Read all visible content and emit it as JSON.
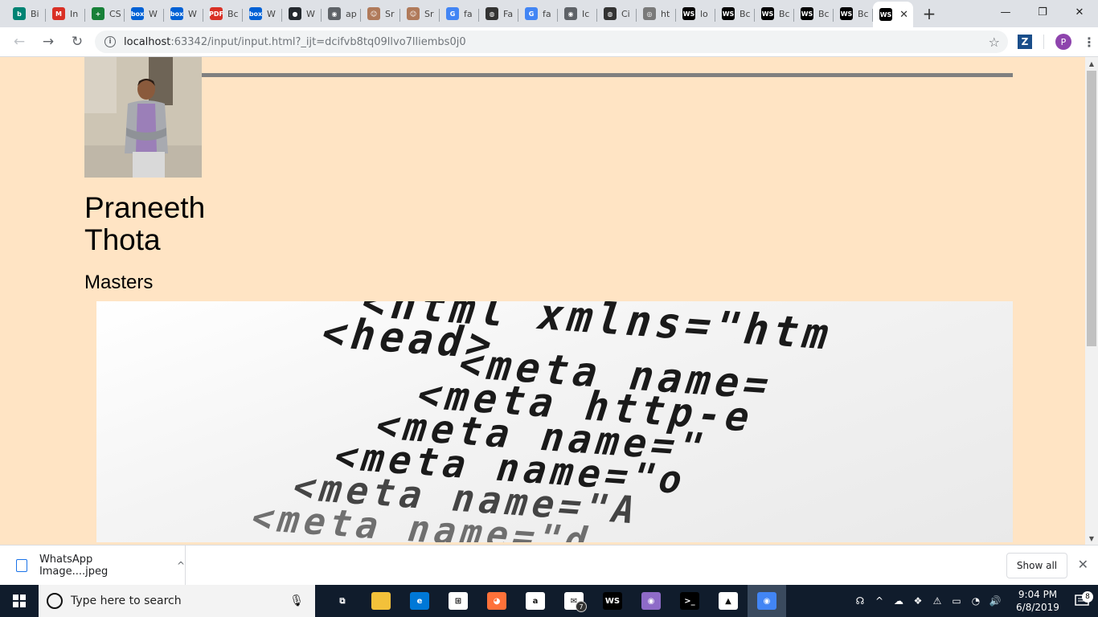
{
  "browser": {
    "tabs": [
      {
        "label": "Bi",
        "icon": "bing-icon",
        "color": "#008373",
        "glyph": "b"
      },
      {
        "label": "In",
        "icon": "gmail-icon",
        "color": "#d93025",
        "glyph": "M"
      },
      {
        "label": "CS",
        "icon": "sheets-icon",
        "color": "#188038",
        "glyph": "+"
      },
      {
        "label": "W",
        "icon": "box-icon",
        "color": "#0061d5",
        "glyph": "box"
      },
      {
        "label": "W",
        "icon": "box-icon",
        "color": "#0061d5",
        "glyph": "box"
      },
      {
        "label": "Bc",
        "icon": "pdf-icon",
        "color": "#d93025",
        "glyph": "PDF"
      },
      {
        "label": "W",
        "icon": "box-icon",
        "color": "#0061d5",
        "glyph": "box"
      },
      {
        "label": "W",
        "icon": "github-icon",
        "color": "#24292e",
        "glyph": "●"
      },
      {
        "label": "ap",
        "icon": "globe-icon",
        "color": "#5f6368",
        "glyph": "◉"
      },
      {
        "label": "Sr",
        "icon": "person-icon",
        "color": "#b07a5a",
        "glyph": "☺"
      },
      {
        "label": "Sr",
        "icon": "person-icon",
        "color": "#b07a5a",
        "glyph": "☺"
      },
      {
        "label": "fa",
        "icon": "google-icon",
        "color": "#4285f4",
        "glyph": "G"
      },
      {
        "label": "Fa",
        "icon": "eye-icon",
        "color": "#333333",
        "glyph": "◍"
      },
      {
        "label": "fa",
        "icon": "google-icon",
        "color": "#4285f4",
        "glyph": "G"
      },
      {
        "label": "Ic",
        "icon": "globe-icon",
        "color": "#5f6368",
        "glyph": "◉"
      },
      {
        "label": "Ci",
        "icon": "eye-icon",
        "color": "#333333",
        "glyph": "◍"
      },
      {
        "label": "ht",
        "icon": "wiki-icon",
        "color": "#7a7a7a",
        "glyph": "◎"
      },
      {
        "label": "lo",
        "icon": "webstorm-icon",
        "color": "#000000",
        "glyph": "WS"
      },
      {
        "label": "Bc",
        "icon": "webstorm-icon",
        "color": "#000000",
        "glyph": "WS"
      },
      {
        "label": "Bc",
        "icon": "webstorm-icon",
        "color": "#000000",
        "glyph": "WS"
      },
      {
        "label": "Bc",
        "icon": "webstorm-icon",
        "color": "#000000",
        "glyph": "WS"
      },
      {
        "label": "Bc",
        "icon": "webstorm-icon",
        "color": "#000000",
        "glyph": "WS"
      }
    ],
    "active_tab": {
      "icon": "webstorm-icon",
      "color": "#000000",
      "glyph": "WS",
      "close": "✕"
    },
    "new_tab": "+",
    "window": {
      "minimize": "—",
      "restore": "❐",
      "close": "✕"
    },
    "nav": {
      "back": "←",
      "forward": "→",
      "reload": "↻"
    },
    "url_host": "localhost",
    "url_rest": ":63342/input/input.html?_ijt=dcifvb8tq09llvo7lliembs0j0",
    "info_glyph": "i",
    "bookmark": "☆",
    "extension": "Z",
    "profile": "P",
    "menu": "⋮"
  },
  "page": {
    "name": "Praneeth Thota",
    "degree": "Masters",
    "code_lines": [
      "<html  xmlns=\"htm",
      "<head>",
      "<meta  name=",
      "<meta  http-e",
      "<meta  name=\"",
      "<meta  name=\"o",
      "<meta  name=\"A",
      "<meta  name=\"d"
    ],
    "bg_color": "#ffe4c4",
    "rule_color": "#808080"
  },
  "downloads": {
    "file_name": "WhatsApp Image....jpeg",
    "chevron": "^",
    "show_all": "Show all",
    "close": "✕"
  },
  "taskbar": {
    "search_placeholder": "Type here to search",
    "mic": "🎙",
    "apps": [
      {
        "name": "task-view-icon",
        "color": "#101c2c",
        "glyph": "⧉"
      },
      {
        "name": "file-explorer-icon",
        "color": "#f3c13a",
        "glyph": ""
      },
      {
        "name": "edge-icon",
        "color": "#0078d7",
        "glyph": "e"
      },
      {
        "name": "store-icon",
        "color": "#ffffff",
        "glyph": "⊞"
      },
      {
        "name": "firefox-icon",
        "color": "#ff7139",
        "glyph": "◕"
      },
      {
        "name": "amazon-icon",
        "color": "#ffffff",
        "glyph": "a"
      },
      {
        "name": "mail-icon",
        "color": "#ffffff",
        "glyph": "✉"
      },
      {
        "name": "webstorm-icon",
        "color": "#000000",
        "glyph": "WS"
      },
      {
        "name": "github-desktop-icon",
        "color": "#8e6bc8",
        "glyph": "◉"
      },
      {
        "name": "terminal-icon",
        "color": "#000000",
        "glyph": ">_"
      },
      {
        "name": "photos-icon",
        "color": "#ffffff",
        "glyph": "▲"
      },
      {
        "name": "chrome-icon",
        "color": "#4285f4",
        "glyph": "◉"
      }
    ],
    "mail_badge": "7",
    "tray_icons": [
      "☊",
      "^",
      "☁",
      "❖",
      "⚠",
      "▭",
      "◔",
      "🔊"
    ],
    "time": "9:04 PM",
    "date": "6/8/2019",
    "notifications": "8"
  }
}
